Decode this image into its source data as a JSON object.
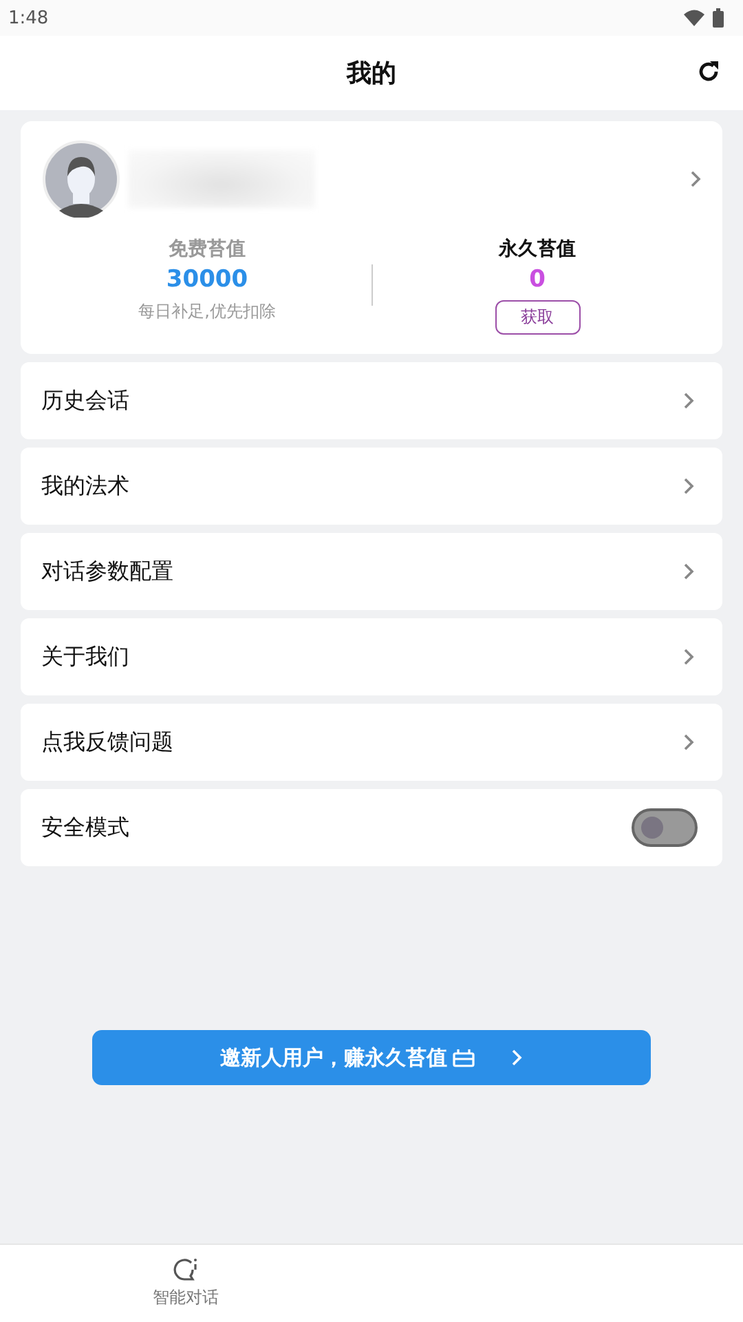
{
  "status_bar": {
    "time": "1:48"
  },
  "header": {
    "title": "我的"
  },
  "profile": {
    "free": {
      "label": "免费苔值",
      "value": "30000",
      "note": "每日补足,优先扣除"
    },
    "permanent": {
      "label": "永久苔值",
      "value": "0",
      "button": "获取"
    }
  },
  "menu": [
    {
      "kind": "link",
      "label": "历史会话"
    },
    {
      "kind": "link",
      "label": "我的法术"
    },
    {
      "kind": "link",
      "label": "对话参数配置"
    },
    {
      "kind": "link",
      "label": "关于我们"
    },
    {
      "kind": "link",
      "label": "点我反馈问题"
    },
    {
      "kind": "toggle",
      "label": "安全模式",
      "on": false
    }
  ],
  "invite_button": {
    "label": "邀新人用户，赚永久苔值"
  },
  "bottom_nav": [
    {
      "label": "智能对话"
    }
  ]
}
